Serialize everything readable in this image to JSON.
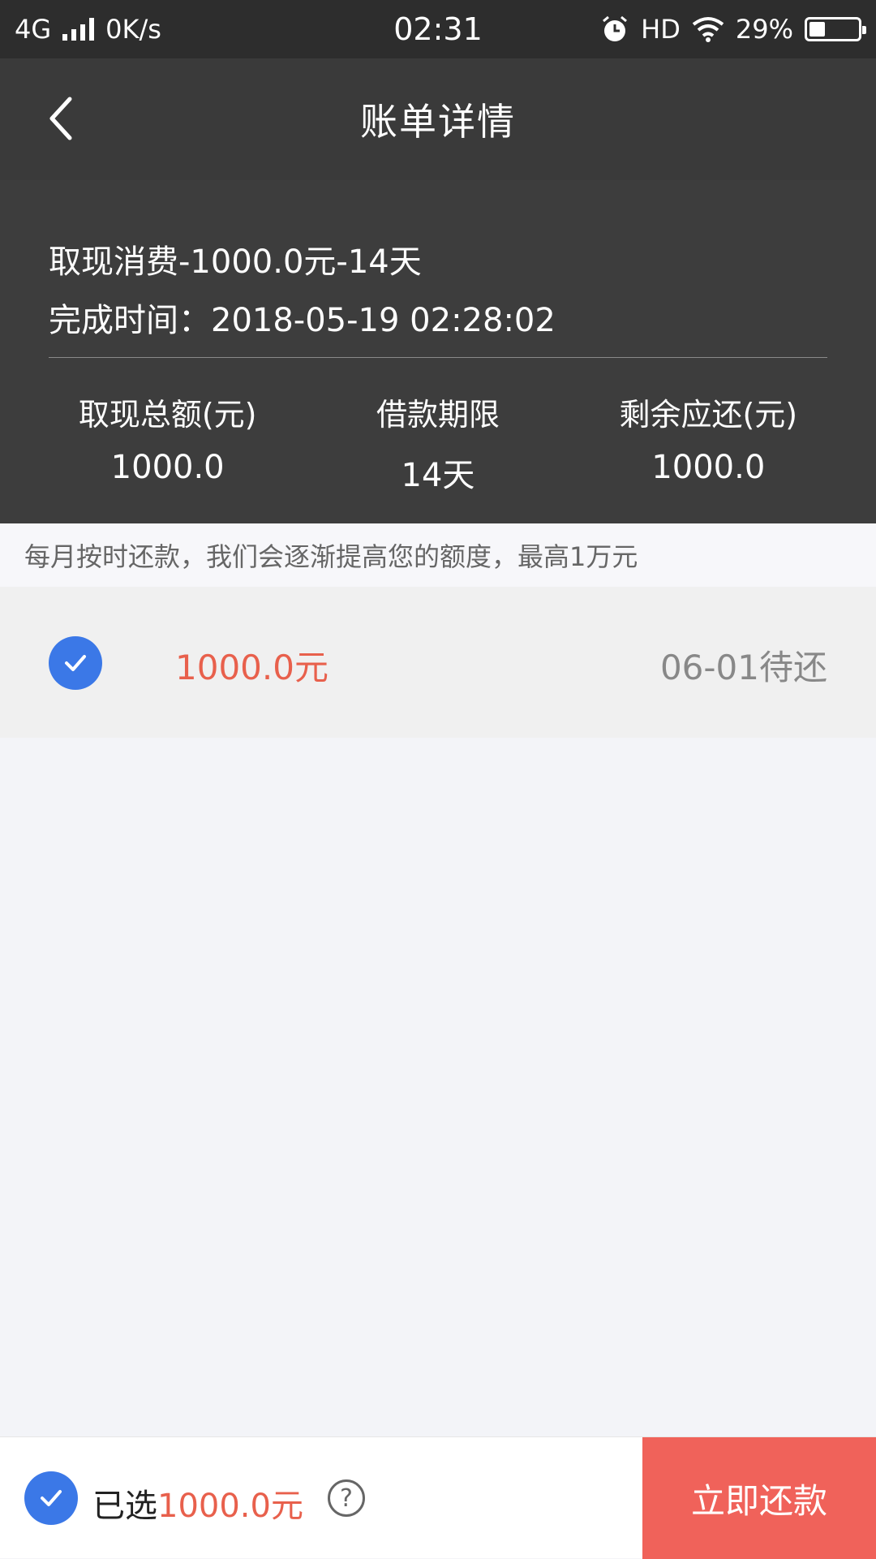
{
  "status_bar": {
    "network": "4G",
    "speed": "0K/s",
    "time": "02:31",
    "hd": "HD",
    "battery": "29%",
    "battery_level": 0.29,
    "icons": [
      "signal-icon",
      "alarm-icon",
      "wifi-icon",
      "battery-icon"
    ]
  },
  "nav": {
    "title": "账单详情",
    "back_icon": "chevron-left-icon"
  },
  "summary": {
    "line1": "取现消费-1000.0元-14天",
    "line2": "完成时间：2018-05-19 02:28:02",
    "stats": [
      {
        "label": "取现总额(元)",
        "value": "1000.0"
      },
      {
        "label": "借款期限",
        "value": "14天"
      },
      {
        "label": "剩余应还(元)",
        "value": "1000.0"
      }
    ]
  },
  "tip": "每月按时还款，我们会逐渐提高您的额度，最高1万元",
  "bills": [
    {
      "amount": "1000.0元",
      "status": "06-01待还",
      "checked": true
    }
  ],
  "bottom": {
    "selected_prefix": "已选",
    "selected_amount": "1000.0元",
    "help_icon": "?",
    "pay_label": "立即还款"
  },
  "colors": {
    "accent_red": "#e8604c",
    "button_red": "#f0625a",
    "check_blue": "#3b78e7",
    "header_dark": "#3a3a3a"
  }
}
